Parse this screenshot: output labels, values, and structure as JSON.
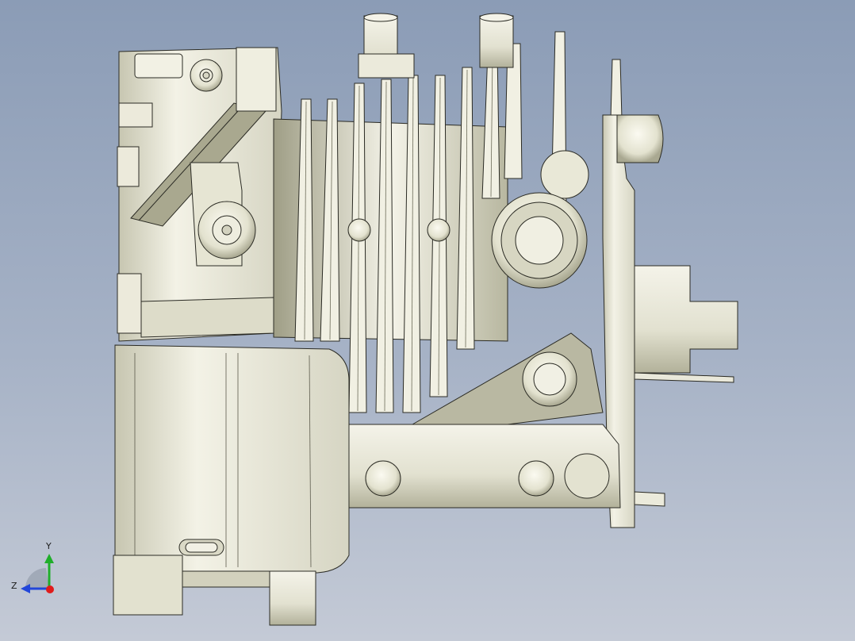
{
  "viewport": {
    "background_top": "#8b9cb6",
    "background_bottom": "#c4cad6"
  },
  "model": {
    "shade_light": "#f2f1e4",
    "shade_mid": "#d9d8c6",
    "shade_dark": "#a8a78f",
    "edge": "#2b2b24"
  },
  "triad": {
    "y_label": "Y",
    "z_label": "Z",
    "y_color": "#1fae2a",
    "z_color": "#2246d9",
    "x_color": "#e01b1b"
  }
}
